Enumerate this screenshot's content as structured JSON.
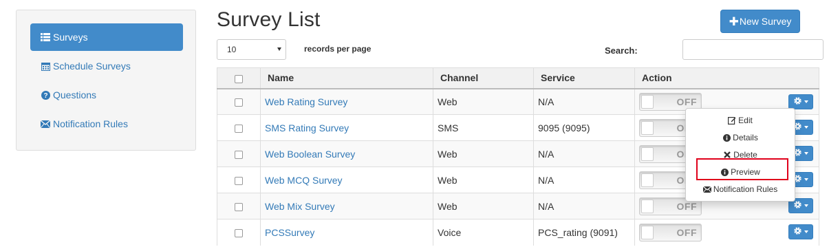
{
  "sidebar": {
    "items": [
      {
        "label": "Surveys",
        "icon": "list-icon",
        "active": true
      },
      {
        "label": "Schedule Surveys",
        "icon": "calendar-icon",
        "active": false
      },
      {
        "label": "Questions",
        "icon": "question-circle-icon",
        "active": false
      },
      {
        "label": "Notification Rules",
        "icon": "envelope-icon",
        "active": false
      }
    ]
  },
  "header": {
    "title": "Survey List",
    "new_button_label": "New Survey"
  },
  "controls": {
    "length_value": "10",
    "length_label": "records per page",
    "search_label": "Search:",
    "search_value": ""
  },
  "table": {
    "columns": [
      "Name",
      "Channel",
      "Service",
      "Action"
    ],
    "rows": [
      {
        "name": "Web Rating Survey",
        "channel": "Web",
        "service": "N/A",
        "toggle": "OFF"
      },
      {
        "name": "SMS Rating Survey",
        "channel": "SMS",
        "service": "9095 (9095)",
        "toggle": "OFF"
      },
      {
        "name": "Web Boolean Survey",
        "channel": "Web",
        "service": "N/A",
        "toggle": "OFF"
      },
      {
        "name": "Web MCQ Survey",
        "channel": "Web",
        "service": "N/A",
        "toggle": "OFF"
      },
      {
        "name": "Web Mix Survey",
        "channel": "Web",
        "service": "N/A",
        "toggle": "OFF"
      },
      {
        "name": "PCSSurvey",
        "channel": "Voice",
        "service": "PCS_rating (9091)",
        "toggle": "OFF"
      }
    ]
  },
  "action_menu": {
    "items": [
      {
        "label": "Edit",
        "icon": "edit-icon"
      },
      {
        "label": "Details",
        "icon": "info-circle-icon"
      },
      {
        "label": "Delete",
        "icon": "times-icon"
      },
      {
        "label": "Preview",
        "icon": "info-circle-icon",
        "highlighted": true
      },
      {
        "label": "Notification Rules",
        "icon": "envelope-icon"
      }
    ]
  },
  "colors": {
    "primary": "#428bca",
    "link": "#337ab7",
    "highlight": "#e0001b"
  }
}
